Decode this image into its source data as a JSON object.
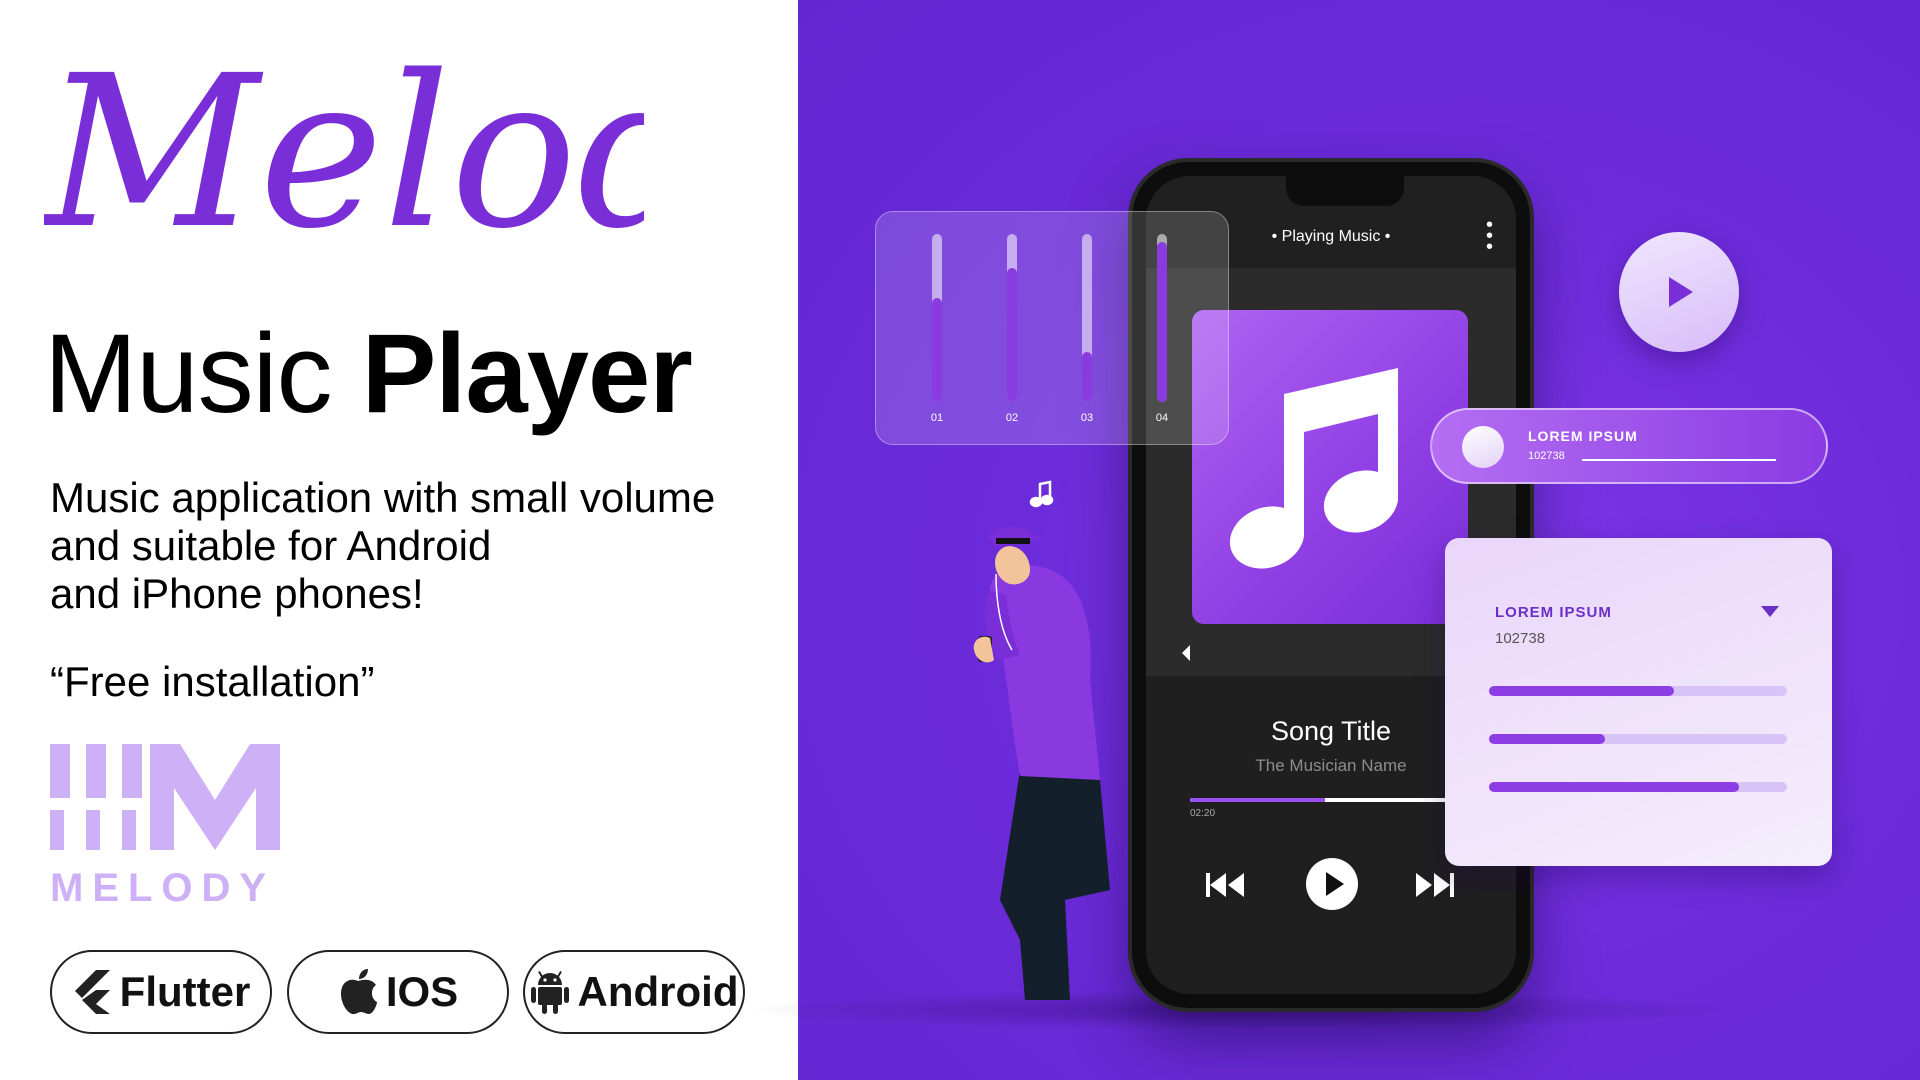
{
  "brand": {
    "script_title": "Melody",
    "headline_light": "Music",
    "headline_bold": "Player",
    "description_lines": [
      "Music application with small volume",
      "and suitable for Android",
      "and iPhone phones!"
    ],
    "quote": "“Free installation”",
    "logo_text": "MELODY",
    "accent_color": "#7a2ed8",
    "background_purple": "#6a2ad8"
  },
  "platforms": [
    {
      "label": "Flutter",
      "icon": "flutter-icon"
    },
    {
      "label": "IOS",
      "icon": "apple-icon"
    },
    {
      "label": "Android",
      "icon": "android-icon"
    }
  ],
  "phone": {
    "header_title": "• Playing Music •",
    "menu_icon": "more-vertical-icon",
    "album_icon": "music-note-icon",
    "song_title": "Song Title",
    "artist": "The Musician Name",
    "elapsed": "02:20",
    "progress": 0.45,
    "controls": [
      "previous-icon",
      "play-icon",
      "next-icon"
    ]
  },
  "equalizer": {
    "bands": [
      {
        "label": "01",
        "level": 0.62
      },
      {
        "label": "02",
        "level": 0.8
      },
      {
        "label": "03",
        "level": 0.3
      },
      {
        "label": "04",
        "level": 0.95
      }
    ]
  },
  "slider_card": {
    "title": "LOREM IPSUM",
    "value": "102738"
  },
  "list_card": {
    "title": "LOREM IPSUM",
    "value": "102738",
    "bars": [
      0.62,
      0.39,
      0.84
    ]
  }
}
